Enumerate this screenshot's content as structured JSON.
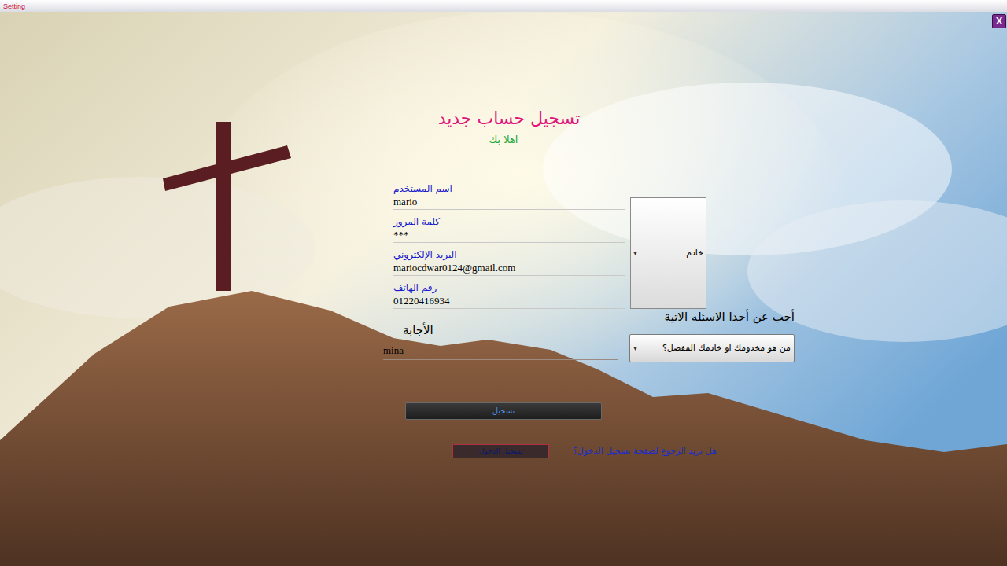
{
  "window": {
    "title": "Setting",
    "close": "X"
  },
  "header": {
    "title": "تسجيل حساب جديد",
    "subtitle": "اهلا بك"
  },
  "fields": [
    {
      "label": "اسم المستخدم",
      "value": "mario"
    },
    {
      "label": "كلمة المرور",
      "value": "***"
    },
    {
      "label": "البريد الإلكتروني",
      "value": "mariocdwar0124@gmail.com"
    },
    {
      "label": "رقم الهاتف",
      "value": "01220416934"
    }
  ],
  "role": {
    "value": "خادم",
    "arrow": "▾"
  },
  "question": {
    "prompt": "أجب عن أحدا الاسئله الاتية",
    "value": "من هو مخدومك او خادمك المفضل؟",
    "arrow": "▾"
  },
  "answer": {
    "label": "الأجابة",
    "value": "mina"
  },
  "buttons": {
    "register": "تسجيل",
    "login": "تسجيل الدخول"
  },
  "link": "هل تريد الرجوع لصفحة تسجيل الدخول؟"
}
